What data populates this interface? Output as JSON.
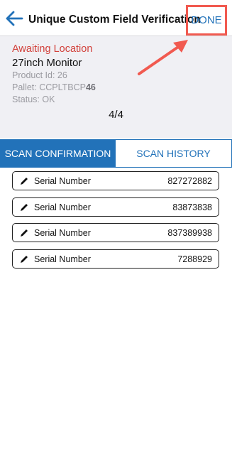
{
  "header": {
    "title": "Unique Custom Field Verification",
    "done_label": "DONE",
    "colors": {
      "accent": "#2272b9",
      "annotation": "#f15a50"
    }
  },
  "info": {
    "status_title": "Awaiting Location",
    "product_name": "27inch Monitor",
    "product_id": "Product Id: 26",
    "pallet_prefix": "Pallet: CCPLTBCP",
    "pallet_suffix": "46",
    "status": "Status: OK",
    "count": "4/4"
  },
  "tabs": [
    {
      "label": "SCAN CONFIRMATION",
      "active": true
    },
    {
      "label": "SCAN HISTORY",
      "active": false
    }
  ],
  "rows": [
    {
      "label": "Serial Number",
      "value": "827272882"
    },
    {
      "label": "Serial Number",
      "value": "83873838"
    },
    {
      "label": "Serial Number",
      "value": "837389938"
    },
    {
      "label": "Serial Number",
      "value": "7288929"
    }
  ],
  "icons": {
    "back": "arrow-left-icon",
    "edit": "pencil-icon"
  }
}
